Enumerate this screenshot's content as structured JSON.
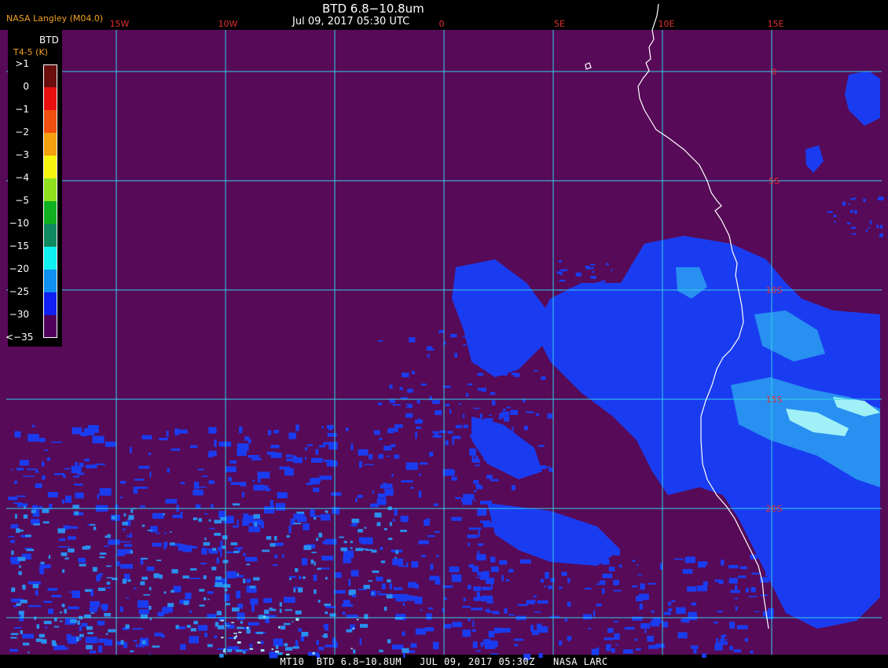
{
  "header": {
    "title": "BTD 6.8−10.8um",
    "subtitle": "Jul 09, 2017 05:30 UTC",
    "org": "NASA Langley (M04.0)"
  },
  "footer": "MT10  BTD 6.8−10.8UM   JUL 09, 2017 05:30Z   NASA LARC",
  "legend": {
    "title": "BTD",
    "subtitle": "T4-5 (K)",
    "labels": [
      ">1",
      "0",
      "−1",
      "−2",
      "−3",
      "−4",
      "−5",
      "−10",
      "−15",
      "−20",
      "−25",
      "−30",
      "<−35"
    ],
    "colors": [
      "#6a0d0d",
      "#e81010",
      "#f05010",
      "#f5a010",
      "#f5f510",
      "#90e020",
      "#10b020",
      "#108860",
      "#10f0f0",
      "#1090f0",
      "#1020f0",
      "#50005a"
    ]
  },
  "grid": {
    "lon_labels": [
      "15W",
      "10W",
      "0",
      "5E",
      "10E",
      "15E"
    ],
    "lat_labels": [
      "0",
      "5S",
      "10S",
      "15S",
      "20S"
    ],
    "line_color": "#30d0e8",
    "label_color": "#e03030"
  },
  "colors": {
    "background": "#570a57",
    "land_outline": "#ffffff",
    "cloud_blue": "#1a3cf0",
    "cloud_light": "#2890f0",
    "cloud_cyan": "#a0f0f8"
  }
}
